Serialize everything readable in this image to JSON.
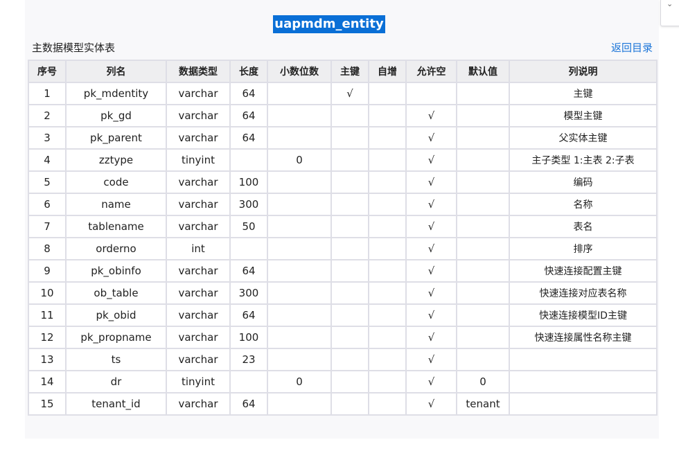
{
  "title": "uapmdm_entity",
  "subtitle": "主数据模型实体表",
  "back_link": "返回目录",
  "table": {
    "headers": [
      "序号",
      "列名",
      "数据类型",
      "长度",
      "小数位数",
      "主键",
      "自增",
      "允许空",
      "默认值",
      "列说明"
    ],
    "rows": [
      [
        "1",
        "pk_mdentity",
        "varchar",
        "64",
        "",
        "√",
        "",
        "",
        "",
        "主键"
      ],
      [
        "2",
        "pk_gd",
        "varchar",
        "64",
        "",
        "",
        "",
        "√",
        "",
        "模型主键"
      ],
      [
        "3",
        "pk_parent",
        "varchar",
        "64",
        "",
        "",
        "",
        "√",
        "",
        "父实体主键"
      ],
      [
        "4",
        "zztype",
        "tinyint",
        "",
        "0",
        "",
        "",
        "√",
        "",
        "主子类型 1:主表 2:子表"
      ],
      [
        "5",
        "code",
        "varchar",
        "100",
        "",
        "",
        "",
        "√",
        "",
        "编码"
      ],
      [
        "6",
        "name",
        "varchar",
        "300",
        "",
        "",
        "",
        "√",
        "",
        "名称"
      ],
      [
        "7",
        "tablename",
        "varchar",
        "50",
        "",
        "",
        "",
        "√",
        "",
        "表名"
      ],
      [
        "8",
        "orderno",
        "int",
        "",
        "",
        "",
        "",
        "√",
        "",
        "排序"
      ],
      [
        "9",
        "pk_obinfo",
        "varchar",
        "64",
        "",
        "",
        "",
        "√",
        "",
        "快速连接配置主键"
      ],
      [
        "10",
        "ob_table",
        "varchar",
        "300",
        "",
        "",
        "",
        "√",
        "",
        "快速连接对应表名称"
      ],
      [
        "11",
        "pk_obid",
        "varchar",
        "64",
        "",
        "",
        "",
        "√",
        "",
        "快速连接模型ID主键"
      ],
      [
        "12",
        "pk_propname",
        "varchar",
        "100",
        "",
        "",
        "",
        "√",
        "",
        "快速连接属性名称主键"
      ],
      [
        "13",
        "ts",
        "varchar",
        "23",
        "",
        "",
        "",
        "√",
        "",
        ""
      ],
      [
        "14",
        "dr",
        "tinyint",
        "",
        "0",
        "",
        "",
        "√",
        "0",
        ""
      ],
      [
        "15",
        "tenant_id",
        "varchar",
        "64",
        "",
        "",
        "",
        "√",
        "tenant",
        ""
      ]
    ]
  }
}
